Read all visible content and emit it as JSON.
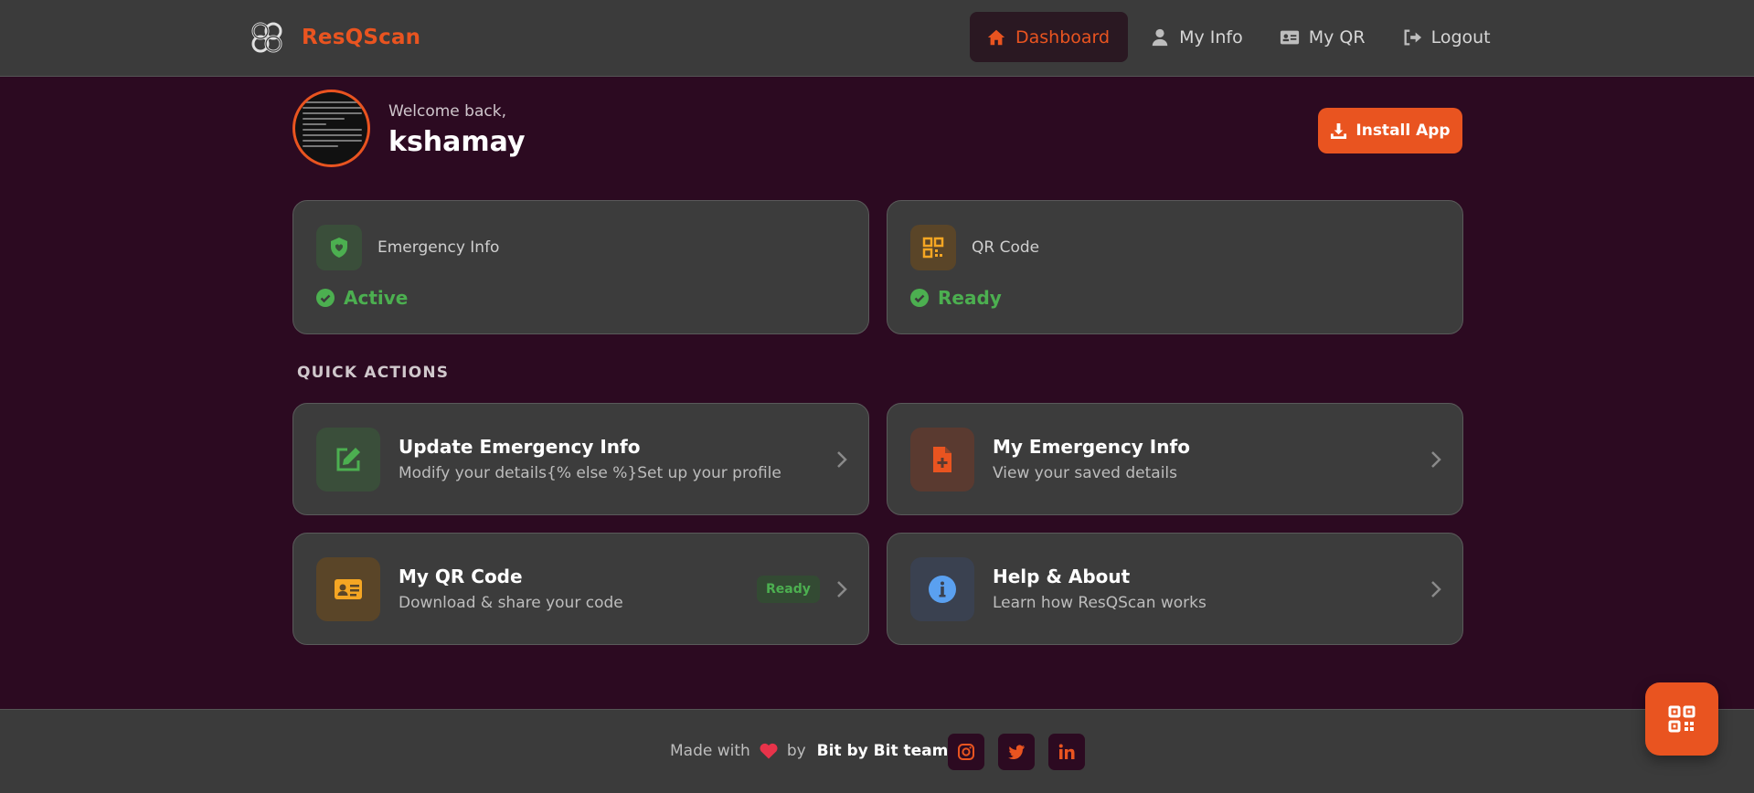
{
  "brand": {
    "name": "ResQScan",
    "accent": "#e95420"
  },
  "nav": {
    "items": [
      {
        "label": "Dashboard",
        "icon": "home-icon",
        "active": true
      },
      {
        "label": "My Info",
        "icon": "user-icon"
      },
      {
        "label": "My QR",
        "icon": "id-card-icon"
      },
      {
        "label": "Logout",
        "icon": "logout-icon"
      }
    ]
  },
  "welcome": {
    "greeting": "Welcome back,",
    "username": "kshamay"
  },
  "install_button": {
    "label": "Install App"
  },
  "status_cards": [
    {
      "label": "Emergency Info",
      "value": "Active",
      "icon": "shield-heart-icon",
      "color": "#4caf50"
    },
    {
      "label": "QR Code",
      "value": "Ready",
      "icon": "qrcode-icon",
      "color": "#f5a623"
    }
  ],
  "quick_actions": {
    "title": "QUICK ACTIONS",
    "items": [
      {
        "title": "Update Emergency Info",
        "subtitle": "Modify your details{% else %}Set up your profile",
        "icon": "edit-icon"
      },
      {
        "title": "My Emergency Info",
        "subtitle": "View your saved details",
        "icon": "medical-file-icon"
      },
      {
        "title": "My QR Code",
        "subtitle": "Download & share your code",
        "icon": "id-card-icon",
        "badge": "Ready"
      },
      {
        "title": "Help & About",
        "subtitle": "Learn how ResQScan works",
        "icon": "info-icon"
      }
    ]
  },
  "footer": {
    "made_with": "Made with",
    "by": "by",
    "team": "Bit by Bit team",
    "social": [
      "instagram-icon",
      "twitter-icon",
      "linkedin-icon"
    ]
  },
  "fab": {
    "icon": "qrcode-icon"
  }
}
